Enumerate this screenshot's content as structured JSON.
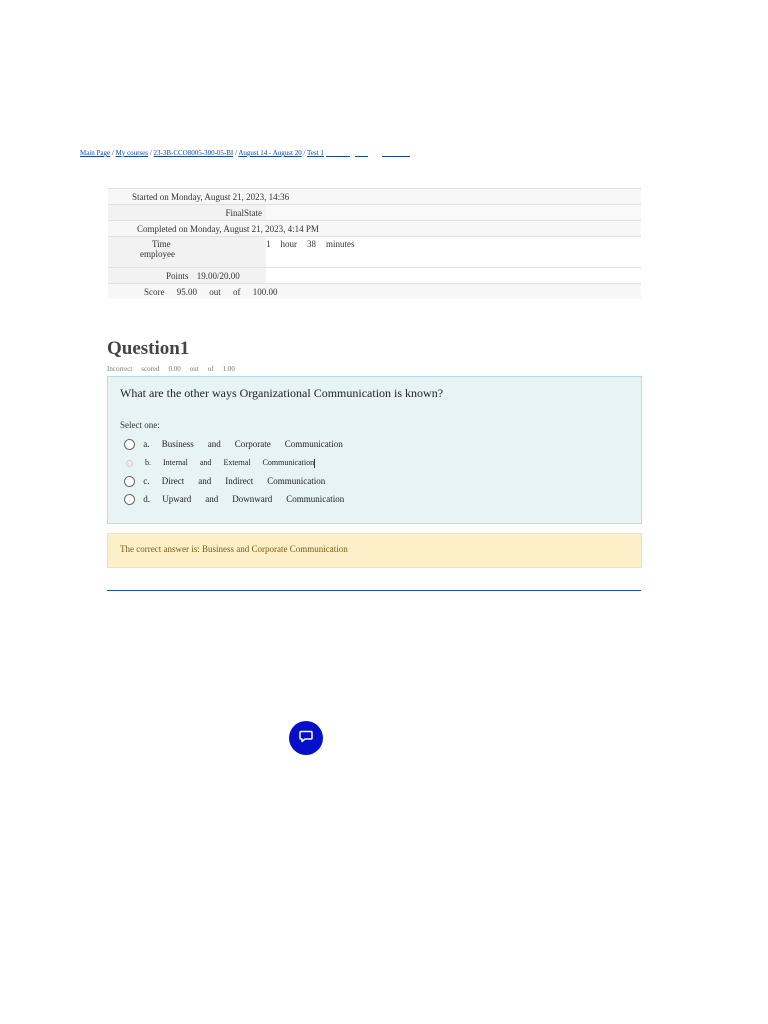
{
  "breadcrumb": {
    "items": [
      "Main Page",
      "My courses",
      "23-3B-CCO8005-300-05-BI",
      "August 14 - August 20",
      "Test 1"
    ],
    "separator": "/"
  },
  "summary": {
    "started_label": "Started on",
    "started_value": "Monday, August 21, 2023, 14:36",
    "state_label": "FinalState",
    "completed_label": "Completed on",
    "completed_value": "Monday, August 21, 2023, 4:14 PM",
    "time_label": "Time",
    "time_words": [
      "1",
      "hour",
      "38",
      "minutes"
    ],
    "time_label2": "employee",
    "points_label": "Points",
    "points_value": "19.00/20.00",
    "score_label": "Score",
    "score_words": [
      "95.00",
      "out",
      "of",
      "100.00"
    ]
  },
  "question": {
    "title": "Question1",
    "meta": [
      "Incorrect",
      "scored",
      "0.00",
      "out",
      "of",
      "1.00"
    ],
    "text": "What are the other ways Organizational Communication is known?",
    "select_label": "Select one:",
    "options": [
      {
        "letter": "a.",
        "words": [
          "Business",
          "and",
          "Corporate",
          "Communication"
        ]
      },
      {
        "letter": "b.",
        "words": [
          "Internal",
          "and",
          "External",
          "Communication"
        ]
      },
      {
        "letter": "c.",
        "words": [
          "Direct",
          "and",
          "Indirect",
          "Communication"
        ]
      },
      {
        "letter": "d.",
        "words": [
          "Upward",
          "and",
          "Downward",
          "Communication"
        ]
      }
    ]
  },
  "feedback": {
    "correct_answer": "The correct answer is: Business and Corporate Communication"
  },
  "colors": {
    "link": "#0f47ad",
    "question_bg": "#e7f3f5",
    "feedback_bg": "#fdf0c8",
    "chat_button": "#0510c8"
  },
  "icons": {
    "chat": "chat-bubble-icon"
  }
}
